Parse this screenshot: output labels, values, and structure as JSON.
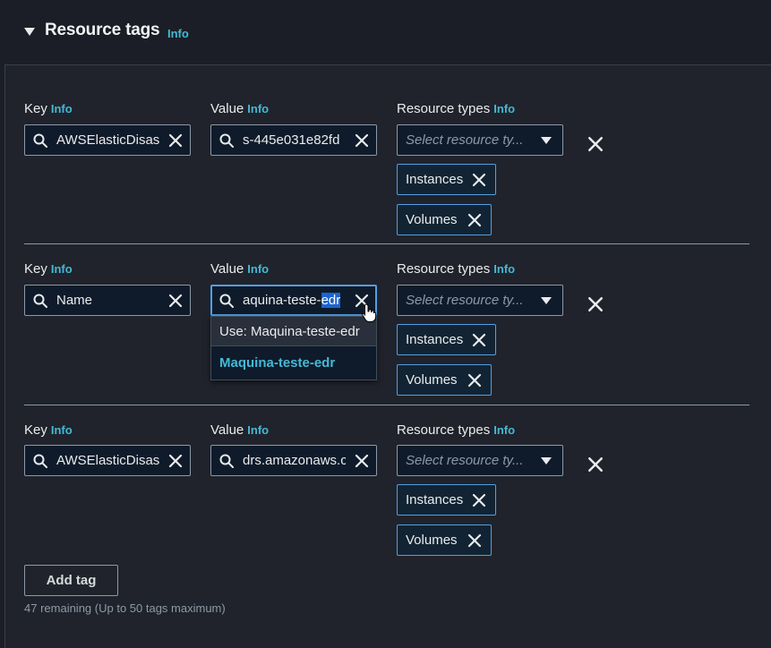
{
  "section": {
    "title": "Resource tags",
    "info": "Info"
  },
  "labels": {
    "key": "Key",
    "value": "Value",
    "resource_types": "Resource types",
    "info": "Info"
  },
  "rows": [
    {
      "key": "AWSElasticDisas",
      "value": "s-445e031e82fd",
      "resource_placeholder": "Select resource ty...",
      "tokens": [
        "Instances",
        "Volumes"
      ]
    },
    {
      "key": "Name",
      "value_prefix": "aquina-teste-",
      "value_selected": "edr",
      "resource_placeholder": "Select resource ty...",
      "tokens": [
        "Instances",
        "Volumes"
      ]
    },
    {
      "key": "AWSElasticDisas",
      "value": "drs.amazonaws.c",
      "resource_placeholder": "Select resource ty...",
      "tokens": [
        "Instances",
        "Volumes"
      ]
    }
  ],
  "dropdown": {
    "use_option": "Use: Maquina-teste-edr",
    "suggestion": "Maquina-teste-edr"
  },
  "add_tag_label": "Add tag",
  "remaining_text": "47 remaining (Up to 50 tags maximum)",
  "colors": {
    "accent": "#44b9d6",
    "focus": "#539fe5",
    "background": "#20232b"
  }
}
